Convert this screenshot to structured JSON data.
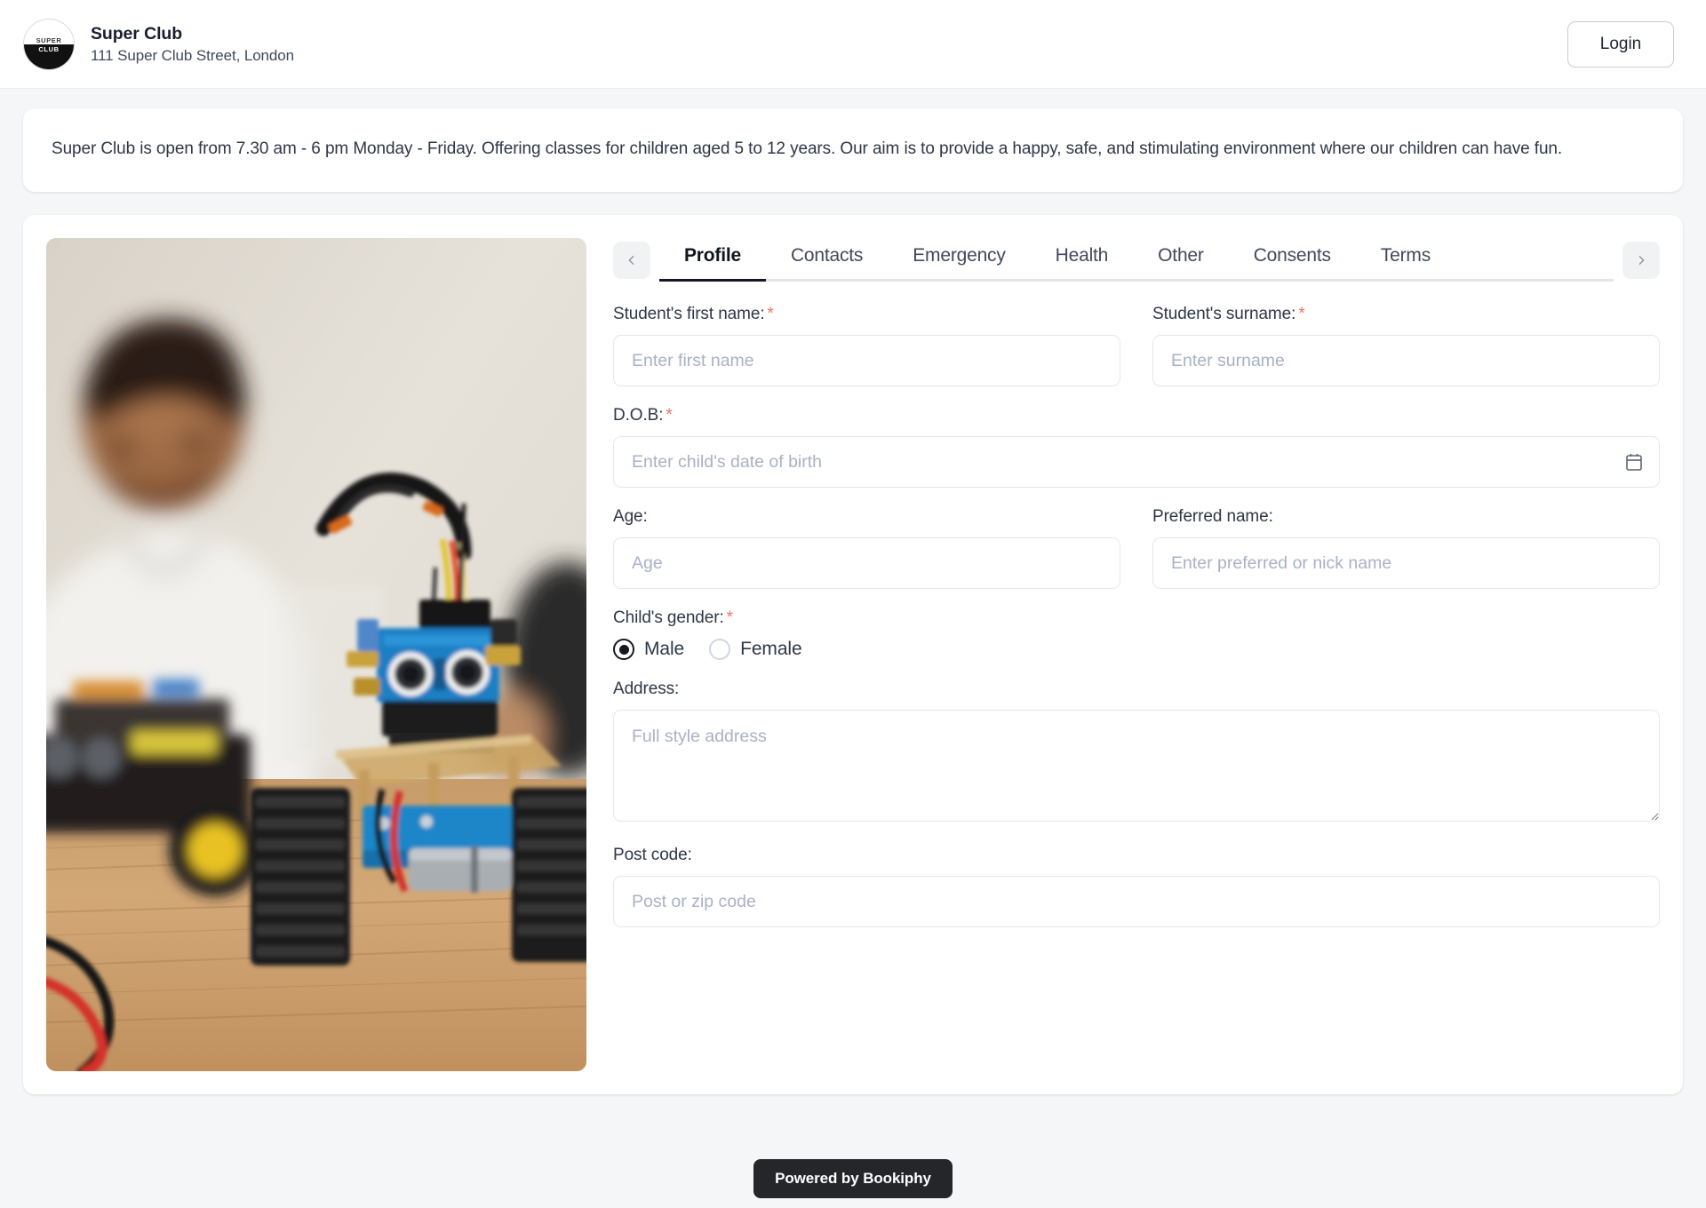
{
  "header": {
    "logo": {
      "top_text": "SUPER",
      "bottom_text": "CLUB"
    },
    "club_name": "Super Club",
    "club_address": "111 Super Club Street, London",
    "login_label": "Login"
  },
  "banner": {
    "text": "Super Club is open from 7.30 am - 6 pm Monday - Friday. Offering classes for children aged 5 to 12 years. Our aim is to provide a happy, safe, and stimulating environment where our children can have fun."
  },
  "tabs": {
    "prev_label": "‹",
    "next_label": "›",
    "items": [
      {
        "label": "Profile",
        "active": true
      },
      {
        "label": "Contacts",
        "active": false
      },
      {
        "label": "Emergency",
        "active": false
      },
      {
        "label": "Health",
        "active": false
      },
      {
        "label": "Other",
        "active": false
      },
      {
        "label": "Consents",
        "active": false
      },
      {
        "label": "Terms",
        "active": false
      }
    ]
  },
  "form": {
    "first_name": {
      "label": "Student's first name:",
      "required": "*",
      "placeholder": "Enter first name",
      "value": ""
    },
    "surname": {
      "label": "Student's surname:",
      "required": "*",
      "placeholder": "Enter surname",
      "value": ""
    },
    "dob": {
      "label": "D.O.B:",
      "required": "*",
      "placeholder": "Enter child's date of birth",
      "value": ""
    },
    "age": {
      "label": "Age:",
      "placeholder": "Age",
      "value": ""
    },
    "preferred_name": {
      "label": "Preferred name:",
      "placeholder": "Enter preferred or nick name",
      "value": ""
    },
    "gender": {
      "label": "Child's gender:",
      "required": "*",
      "options": [
        {
          "label": "Male",
          "selected": true
        },
        {
          "label": "Female",
          "selected": false
        }
      ]
    },
    "address": {
      "label": "Address:",
      "placeholder": "Full style address",
      "value": ""
    },
    "post_code": {
      "label": "Post code:",
      "placeholder": "Post or zip code",
      "value": ""
    }
  },
  "footer": {
    "badge_label": "Powered by Bookiphy"
  },
  "colors": {
    "page_bg": "#f5f6f8",
    "card_bg": "#ffffff",
    "required_asterisk": "#f0755a",
    "active_tab_underline": "#15191f",
    "badge_bg": "#25262a",
    "placeholder": "#a8b2c4"
  }
}
